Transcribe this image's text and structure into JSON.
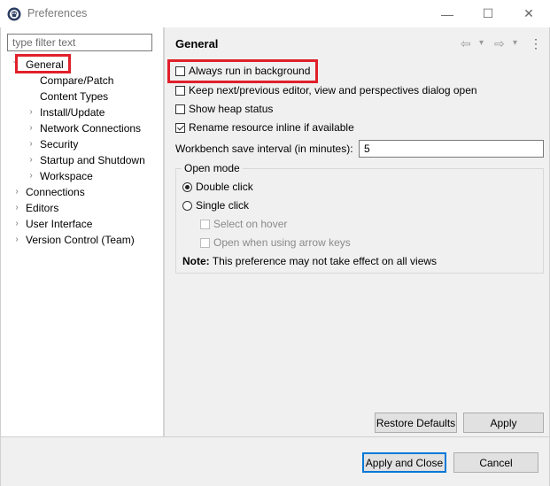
{
  "window": {
    "title": "Preferences",
    "minimize_glyph": "—",
    "maximize_glyph": "☐",
    "close_glyph": "✕"
  },
  "filter": {
    "placeholder": "type filter text",
    "value": ""
  },
  "tree": {
    "general": "General",
    "compare_patch": "Compare/Patch",
    "content_types": "Content Types",
    "install_update": "Install/Update",
    "network_connections": "Network Connections",
    "security": "Security",
    "startup_shutdown": "Startup and Shutdown",
    "workspace": "Workspace",
    "connections": "Connections",
    "editors": "Editors",
    "user_interface": "User Interface",
    "version_control": "Version Control (Team)"
  },
  "page": {
    "title": "General",
    "nav_back_glyph": "⇦",
    "nav_forward_glyph": "⇨",
    "menu_glyph": "▾",
    "more_glyph": "⋮"
  },
  "options": {
    "always_run_background": {
      "label": "Always run in background",
      "checked": false
    },
    "keep_next_prev": {
      "label": "Keep next/previous editor, view and perspectives dialog open",
      "checked": false
    },
    "show_heap": {
      "label": "Show heap status",
      "checked": false
    },
    "rename_inline": {
      "label": "Rename resource inline if available",
      "checked": true
    }
  },
  "save_interval": {
    "label": "Workbench save interval (in minutes):",
    "value": "5"
  },
  "open_mode": {
    "legend": "Open mode",
    "double_click": "Double click",
    "single_click": "Single click",
    "select_on_hover": "Select on hover",
    "open_arrow_keys": "Open when using arrow keys",
    "note_label": "Note:",
    "note_text": "This preference may not take effect on all views",
    "selected": "Double click"
  },
  "buttons": {
    "restore_defaults": "Restore Defaults",
    "apply": "Apply",
    "apply_close": "Apply and Close",
    "cancel": "Cancel"
  },
  "colors": {
    "highlight": "#e0202a",
    "default_button_border": "#0078d7",
    "panel_bg": "#f0f0f0"
  }
}
